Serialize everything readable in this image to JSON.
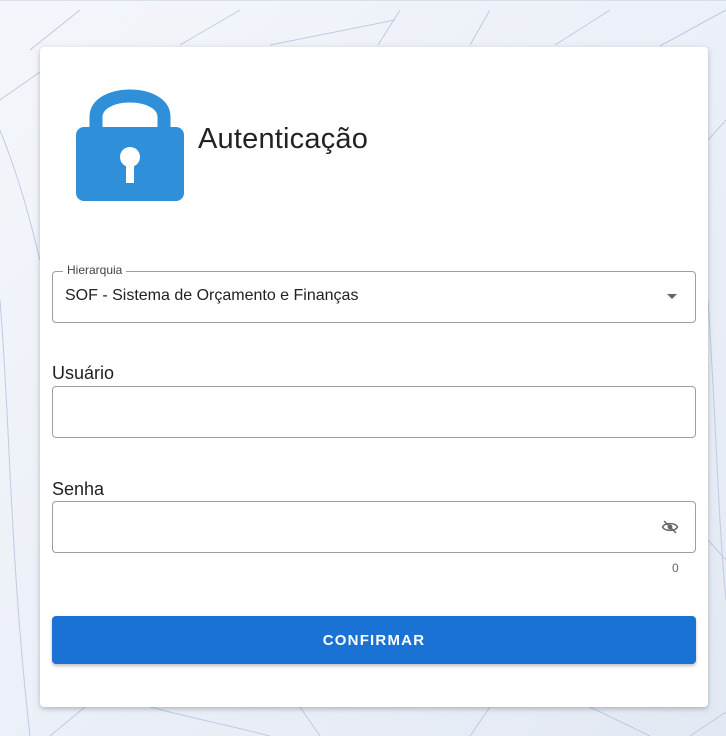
{
  "colors": {
    "accent": "#1a73d4",
    "lock_icon": "#2f8fd8",
    "background_lines": "#bfcbe2"
  },
  "header": {
    "icon": "lock-icon",
    "title": "Autenticação"
  },
  "hierarchy": {
    "label": "Hierarquia",
    "value": "SOF - Sistema de Orçamento e Finanças",
    "icon": "dropdown-arrow-icon"
  },
  "user": {
    "label": "Usuário",
    "value": "",
    "placeholder": ""
  },
  "password": {
    "label": "Senha",
    "value": "",
    "placeholder": "",
    "icon": "eye-off-icon",
    "counter": "0"
  },
  "actions": {
    "confirm_label": "CONFIRMAR"
  }
}
